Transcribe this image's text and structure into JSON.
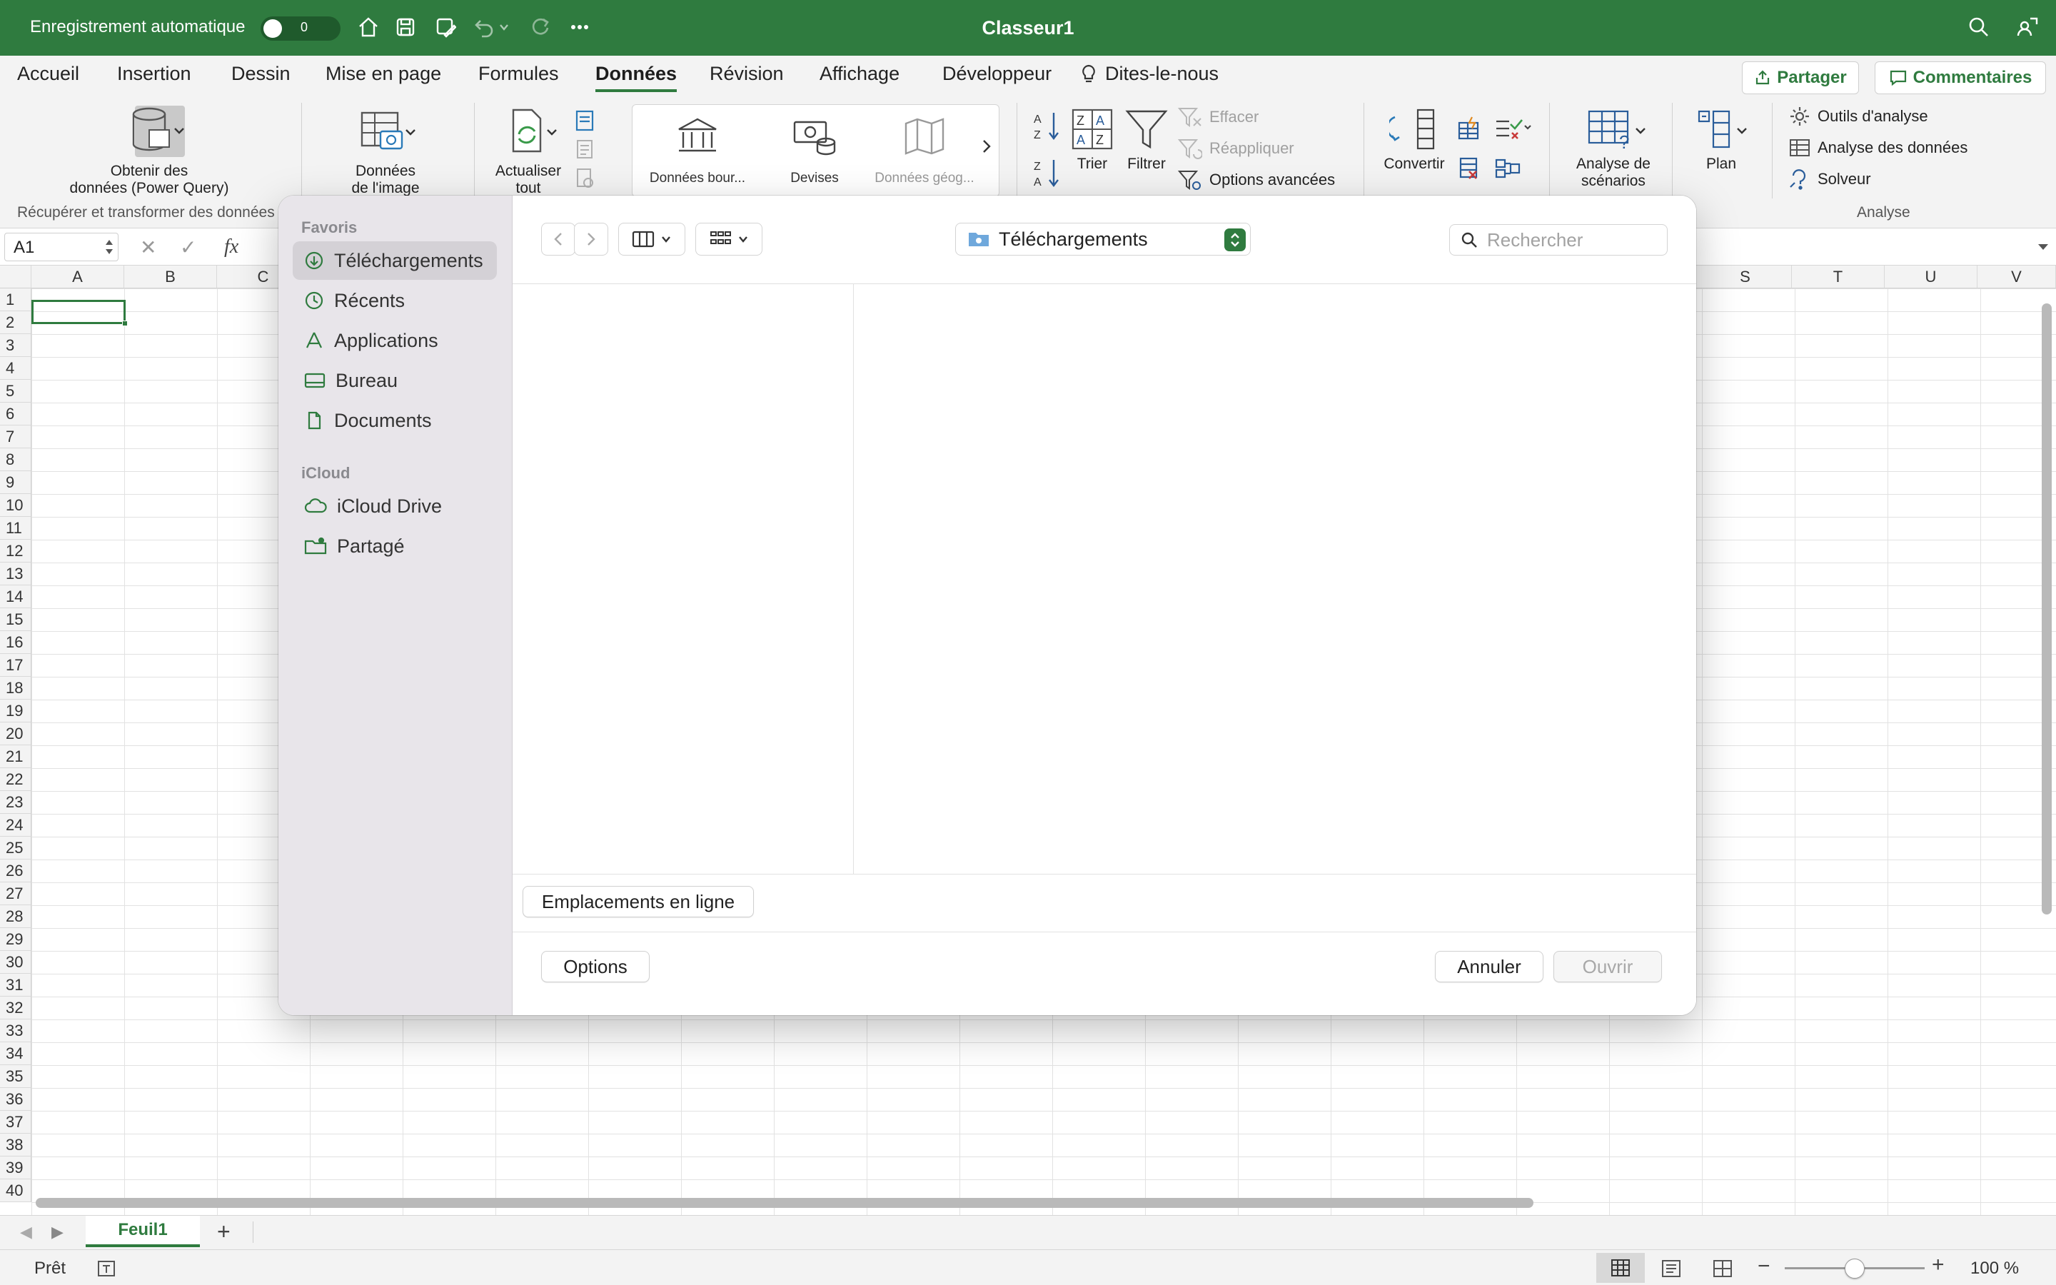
{
  "titlebar": {
    "autosave_label": "Enregistrement automatique",
    "autosave_state": "0",
    "document_title": "Classeur1"
  },
  "tabs": [
    {
      "label": "Accueil"
    },
    {
      "label": "Insertion"
    },
    {
      "label": "Dessin"
    },
    {
      "label": "Mise en page"
    },
    {
      "label": "Formules"
    },
    {
      "label": "Données"
    },
    {
      "label": "Révision"
    },
    {
      "label": "Affichage"
    },
    {
      "label": "Développeur"
    },
    {
      "label": "Dites-le-nous"
    }
  ],
  "share_label": "Partager",
  "comments_label": "Commentaires",
  "ribbon": {
    "get_data_line1": "Obtenir des",
    "get_data_line2": "données (Power Query)",
    "image_data_line1": "Données",
    "image_data_line2": "de l'image",
    "refresh_line1": "Actualiser",
    "refresh_line2": "tout",
    "gallery": [
      "Données bour...",
      "Devises",
      "Données géog..."
    ],
    "sort": "Trier",
    "filter": "Filtrer",
    "clear": "Effacer",
    "reapply": "Réappliquer",
    "advanced": "Options avancées",
    "convert": "Convertir",
    "whatif_line1": "Analyse de",
    "whatif_line2": "scénarios",
    "outline": "Plan",
    "analysis_tools": "Outils d'analyse",
    "data_analysis": "Analyse des données",
    "solver": "Solveur",
    "group_get_transform": "Récupérer et transformer des données",
    "group_analysis": "Analyse"
  },
  "formula_bar": {
    "name_box": "A1",
    "fx": "fx"
  },
  "columns_left": [
    "A",
    "B",
    "C"
  ],
  "columns_right": [
    "S",
    "T",
    "U",
    "V"
  ],
  "rows": [
    "1",
    "2",
    "3",
    "4",
    "5",
    "6",
    "7",
    "8",
    "9",
    "10",
    "11",
    "12",
    "13",
    "14",
    "15",
    "16",
    "17",
    "18",
    "19",
    "20",
    "21",
    "22",
    "23",
    "24",
    "25",
    "26",
    "27",
    "28",
    "29",
    "30",
    "31",
    "32",
    "33",
    "34",
    "35",
    "36",
    "37",
    "38",
    "39",
    "40"
  ],
  "sheet_tab": "Feuil1",
  "status": {
    "ready": "Prêt",
    "zoom": "100 %",
    "zoom_fraction": 0.5
  },
  "dialog": {
    "favorites_title": "Favoris",
    "favorites": [
      {
        "label": "Téléchargements"
      },
      {
        "label": "Récents"
      },
      {
        "label": "Applications"
      },
      {
        "label": "Bureau"
      },
      {
        "label": "Documents"
      }
    ],
    "icloud_title": "iCloud",
    "icloud": [
      {
        "label": "iCloud Drive"
      },
      {
        "label": "Partagé"
      }
    ],
    "location": "Téléchargements",
    "search_placeholder": "Rechercher",
    "online_locations": "Emplacements en ligne",
    "options": "Options",
    "cancel": "Annuler",
    "open": "Ouvrir"
  },
  "colors": {
    "accent": "#2f7b3f"
  }
}
